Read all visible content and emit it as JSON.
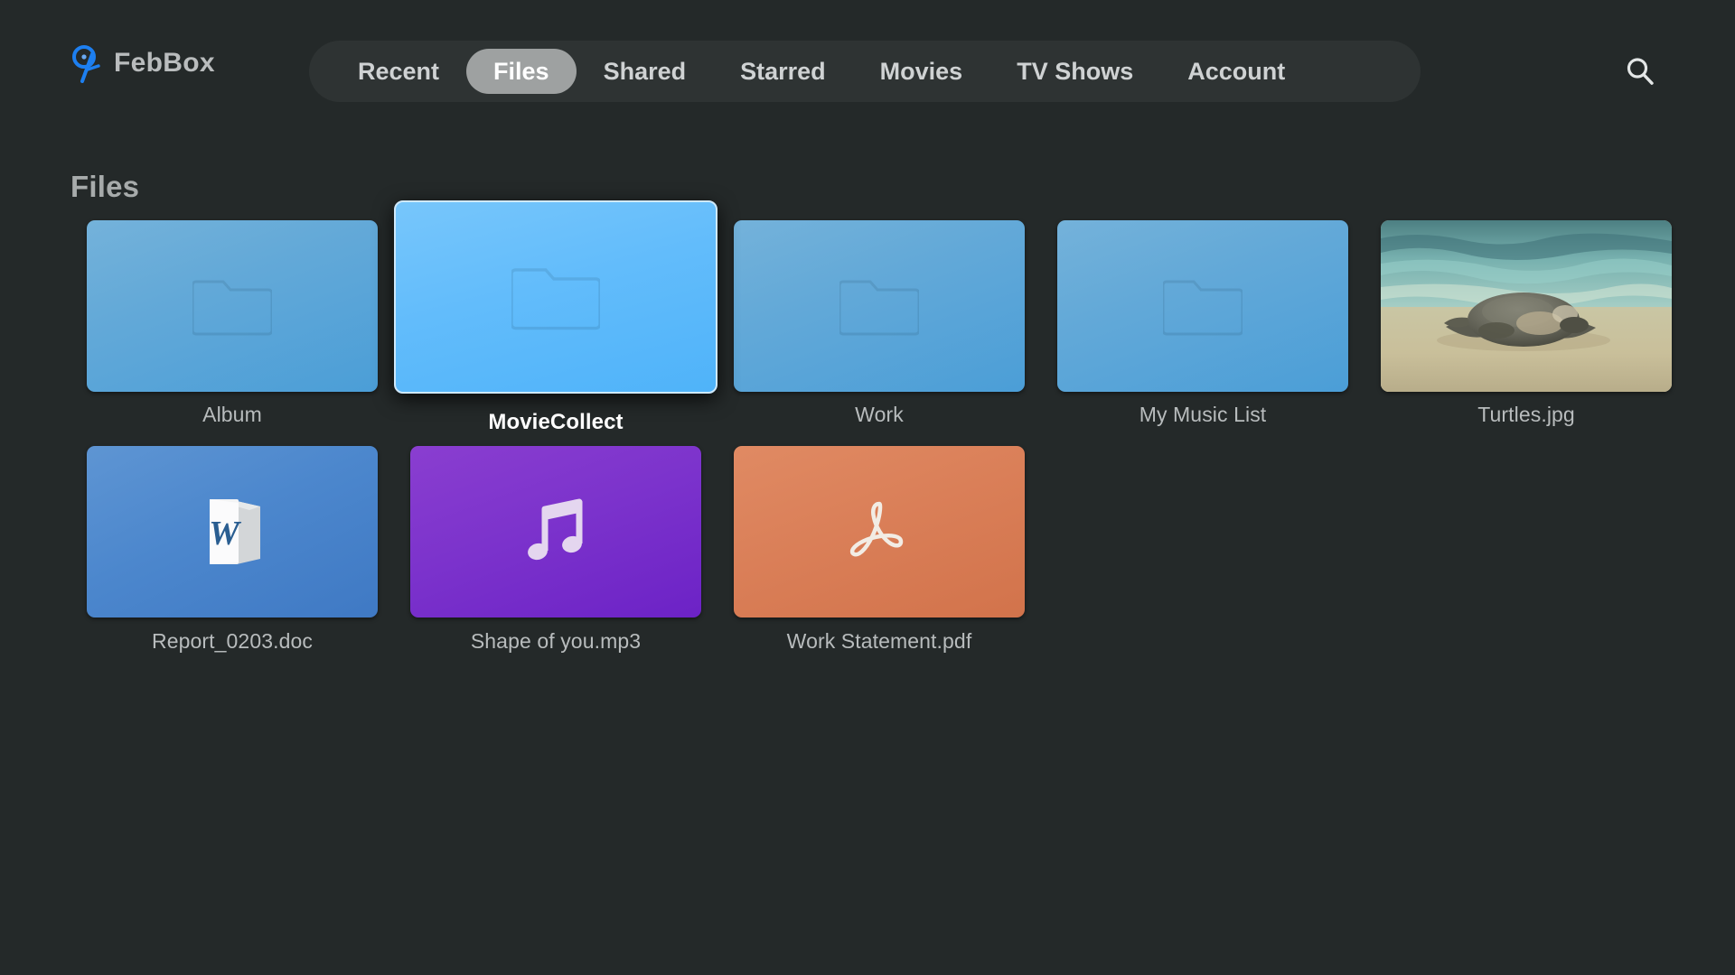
{
  "app": {
    "brand_name": "FebBox",
    "logo_icon": "febbox-logo-icon",
    "background_color": "#242929"
  },
  "nav": {
    "search_icon": "search-icon",
    "items": [
      {
        "label": "Recent",
        "active": false
      },
      {
        "label": "Files",
        "active": true
      },
      {
        "label": "Shared",
        "active": false
      },
      {
        "label": "Starred",
        "active": false
      },
      {
        "label": "Movies",
        "active": false
      },
      {
        "label": "TV Shows",
        "active": false
      },
      {
        "label": "Account",
        "active": false
      }
    ],
    "active_color": "#9ea1a1",
    "bar_color": "#2e3333"
  },
  "main": {
    "section_title": "Files",
    "rows": [
      {
        "items": [
          {
            "name": "Album",
            "kind": "folder",
            "icon": "folder-icon",
            "selected": false
          },
          {
            "name": "MovieCollect",
            "kind": "folder",
            "icon": "folder-icon",
            "selected": true
          },
          {
            "name": "Work",
            "kind": "folder",
            "icon": "folder-icon",
            "selected": false
          },
          {
            "name": "My Music List",
            "kind": "folder",
            "icon": "folder-icon",
            "selected": false
          },
          {
            "name": "Turtles.jpg",
            "kind": "photo",
            "icon": "image-thumbnail",
            "selected": false
          }
        ]
      },
      {
        "items": [
          {
            "name": "Report_0203.doc",
            "kind": "doc",
            "icon": "word-document-icon",
            "selected": false
          },
          {
            "name": "Shape of you.mp3",
            "kind": "mp3",
            "icon": "music-note-icon",
            "selected": false
          },
          {
            "name": "Work Statement.pdf",
            "kind": "pdf",
            "icon": "pdf-acrobat-icon",
            "selected": false
          }
        ]
      }
    ]
  },
  "colors": {
    "folder_tile": "#63a9d8",
    "selected_tile": "#62bcfb",
    "doc_tile": "#4c87cd",
    "mp3_tile": "#7c33cc",
    "pdf_tile": "#da7f58",
    "logo_blue": "#1d7ff0",
    "label_text": "#b8bcbd",
    "selected_label_text": "#ffffff"
  }
}
